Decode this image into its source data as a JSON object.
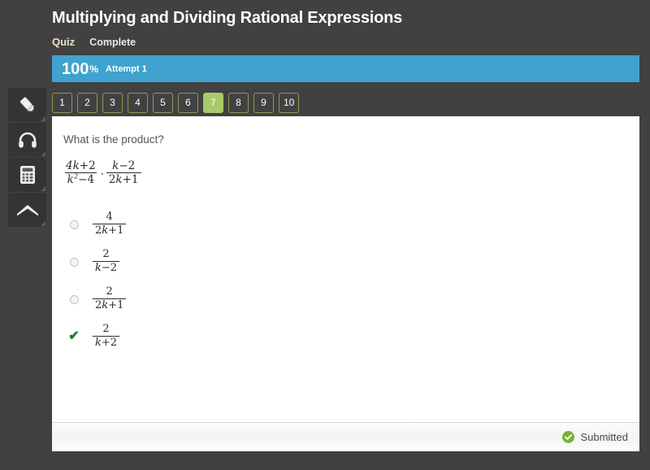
{
  "header": {
    "title": "Multiplying and Dividing Rational Expressions",
    "kind_label": "Quiz",
    "status_label": "Complete"
  },
  "score": {
    "value": "100",
    "percent_symbol": "%",
    "attempt_label": "Attempt 1",
    "bar_color": "#3fa2cf"
  },
  "question_nav": {
    "buttons": [
      {
        "label": "1",
        "active": false
      },
      {
        "label": "2",
        "active": false
      },
      {
        "label": "3",
        "active": false
      },
      {
        "label": "4",
        "active": false
      },
      {
        "label": "5",
        "active": false
      },
      {
        "label": "6",
        "active": false
      },
      {
        "label": "7",
        "active": true
      },
      {
        "label": "8",
        "active": false
      },
      {
        "label": "9",
        "active": false
      },
      {
        "label": "10",
        "active": false
      }
    ],
    "active_color": "#a8ca6a",
    "border_color": "#8d9a52"
  },
  "toolbar": {
    "items": [
      {
        "icon": "pencil-icon",
        "name": "highlighter-tool"
      },
      {
        "icon": "headphones-icon",
        "name": "audio-tool"
      },
      {
        "icon": "calculator-icon",
        "name": "calculator-tool"
      },
      {
        "icon": "chevron-up-icon",
        "name": "collapse-tool"
      }
    ]
  },
  "question": {
    "prompt": "What is the product?",
    "expression": {
      "left": {
        "numerator": "4k+2",
        "denominator": "k2-4"
      },
      "operator": "·",
      "right": {
        "numerator": "k-2",
        "denominator": "2k+1"
      }
    },
    "options": [
      {
        "numerator": "4",
        "denominator": "2k+1",
        "state": "unselected"
      },
      {
        "numerator": "2",
        "denominator": "k-2",
        "state": "unselected"
      },
      {
        "numerator": "2",
        "denominator": "2k+1",
        "state": "unselected"
      },
      {
        "numerator": "2",
        "denominator": "k+2",
        "state": "correct"
      }
    ]
  },
  "footer": {
    "status_label": "Submitted",
    "status_icon": "check-circle-icon",
    "status_color": "#78b338"
  }
}
